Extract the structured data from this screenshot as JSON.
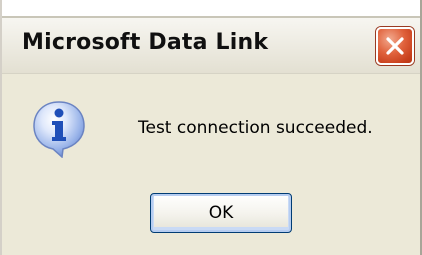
{
  "window": {
    "title": "Microsoft Data Link",
    "close_icon": "close-icon"
  },
  "dialog": {
    "icon": "info-icon",
    "message": "Test connection succeeded.",
    "ok_label": "OK"
  },
  "colors": {
    "dialog_bg": "#ece9d8",
    "close_button": "#e0623c",
    "button_border": "#003c74",
    "info_icon_blue": "#2a5fc4"
  }
}
